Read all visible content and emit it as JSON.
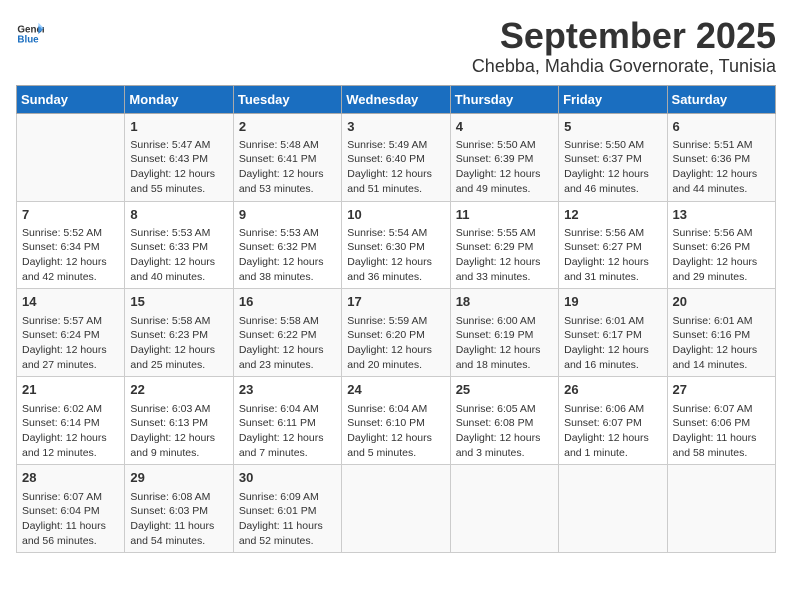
{
  "logo": {
    "line1": "General",
    "line2": "Blue"
  },
  "title": "September 2025",
  "subtitle": "Chebba, Mahdia Governorate, Tunisia",
  "headers": [
    "Sunday",
    "Monday",
    "Tuesday",
    "Wednesday",
    "Thursday",
    "Friday",
    "Saturday"
  ],
  "weeks": [
    [
      {
        "day": "",
        "info": ""
      },
      {
        "day": "1",
        "info": "Sunrise: 5:47 AM\nSunset: 6:43 PM\nDaylight: 12 hours\nand 55 minutes."
      },
      {
        "day": "2",
        "info": "Sunrise: 5:48 AM\nSunset: 6:41 PM\nDaylight: 12 hours\nand 53 minutes."
      },
      {
        "day": "3",
        "info": "Sunrise: 5:49 AM\nSunset: 6:40 PM\nDaylight: 12 hours\nand 51 minutes."
      },
      {
        "day": "4",
        "info": "Sunrise: 5:50 AM\nSunset: 6:39 PM\nDaylight: 12 hours\nand 49 minutes."
      },
      {
        "day": "5",
        "info": "Sunrise: 5:50 AM\nSunset: 6:37 PM\nDaylight: 12 hours\nand 46 minutes."
      },
      {
        "day": "6",
        "info": "Sunrise: 5:51 AM\nSunset: 6:36 PM\nDaylight: 12 hours\nand 44 minutes."
      }
    ],
    [
      {
        "day": "7",
        "info": "Sunrise: 5:52 AM\nSunset: 6:34 PM\nDaylight: 12 hours\nand 42 minutes."
      },
      {
        "day": "8",
        "info": "Sunrise: 5:53 AM\nSunset: 6:33 PM\nDaylight: 12 hours\nand 40 minutes."
      },
      {
        "day": "9",
        "info": "Sunrise: 5:53 AM\nSunset: 6:32 PM\nDaylight: 12 hours\nand 38 minutes."
      },
      {
        "day": "10",
        "info": "Sunrise: 5:54 AM\nSunset: 6:30 PM\nDaylight: 12 hours\nand 36 minutes."
      },
      {
        "day": "11",
        "info": "Sunrise: 5:55 AM\nSunset: 6:29 PM\nDaylight: 12 hours\nand 33 minutes."
      },
      {
        "day": "12",
        "info": "Sunrise: 5:56 AM\nSunset: 6:27 PM\nDaylight: 12 hours\nand 31 minutes."
      },
      {
        "day": "13",
        "info": "Sunrise: 5:56 AM\nSunset: 6:26 PM\nDaylight: 12 hours\nand 29 minutes."
      }
    ],
    [
      {
        "day": "14",
        "info": "Sunrise: 5:57 AM\nSunset: 6:24 PM\nDaylight: 12 hours\nand 27 minutes."
      },
      {
        "day": "15",
        "info": "Sunrise: 5:58 AM\nSunset: 6:23 PM\nDaylight: 12 hours\nand 25 minutes."
      },
      {
        "day": "16",
        "info": "Sunrise: 5:58 AM\nSunset: 6:22 PM\nDaylight: 12 hours\nand 23 minutes."
      },
      {
        "day": "17",
        "info": "Sunrise: 5:59 AM\nSunset: 6:20 PM\nDaylight: 12 hours\nand 20 minutes."
      },
      {
        "day": "18",
        "info": "Sunrise: 6:00 AM\nSunset: 6:19 PM\nDaylight: 12 hours\nand 18 minutes."
      },
      {
        "day": "19",
        "info": "Sunrise: 6:01 AM\nSunset: 6:17 PM\nDaylight: 12 hours\nand 16 minutes."
      },
      {
        "day": "20",
        "info": "Sunrise: 6:01 AM\nSunset: 6:16 PM\nDaylight: 12 hours\nand 14 minutes."
      }
    ],
    [
      {
        "day": "21",
        "info": "Sunrise: 6:02 AM\nSunset: 6:14 PM\nDaylight: 12 hours\nand 12 minutes."
      },
      {
        "day": "22",
        "info": "Sunrise: 6:03 AM\nSunset: 6:13 PM\nDaylight: 12 hours\nand 9 minutes."
      },
      {
        "day": "23",
        "info": "Sunrise: 6:04 AM\nSunset: 6:11 PM\nDaylight: 12 hours\nand 7 minutes."
      },
      {
        "day": "24",
        "info": "Sunrise: 6:04 AM\nSunset: 6:10 PM\nDaylight: 12 hours\nand 5 minutes."
      },
      {
        "day": "25",
        "info": "Sunrise: 6:05 AM\nSunset: 6:08 PM\nDaylight: 12 hours\nand 3 minutes."
      },
      {
        "day": "26",
        "info": "Sunrise: 6:06 AM\nSunset: 6:07 PM\nDaylight: 12 hours\nand 1 minute."
      },
      {
        "day": "27",
        "info": "Sunrise: 6:07 AM\nSunset: 6:06 PM\nDaylight: 11 hours\nand 58 minutes."
      }
    ],
    [
      {
        "day": "28",
        "info": "Sunrise: 6:07 AM\nSunset: 6:04 PM\nDaylight: 11 hours\nand 56 minutes."
      },
      {
        "day": "29",
        "info": "Sunrise: 6:08 AM\nSunset: 6:03 PM\nDaylight: 11 hours\nand 54 minutes."
      },
      {
        "day": "30",
        "info": "Sunrise: 6:09 AM\nSunset: 6:01 PM\nDaylight: 11 hours\nand 52 minutes."
      },
      {
        "day": "",
        "info": ""
      },
      {
        "day": "",
        "info": ""
      },
      {
        "day": "",
        "info": ""
      },
      {
        "day": "",
        "info": ""
      }
    ]
  ]
}
